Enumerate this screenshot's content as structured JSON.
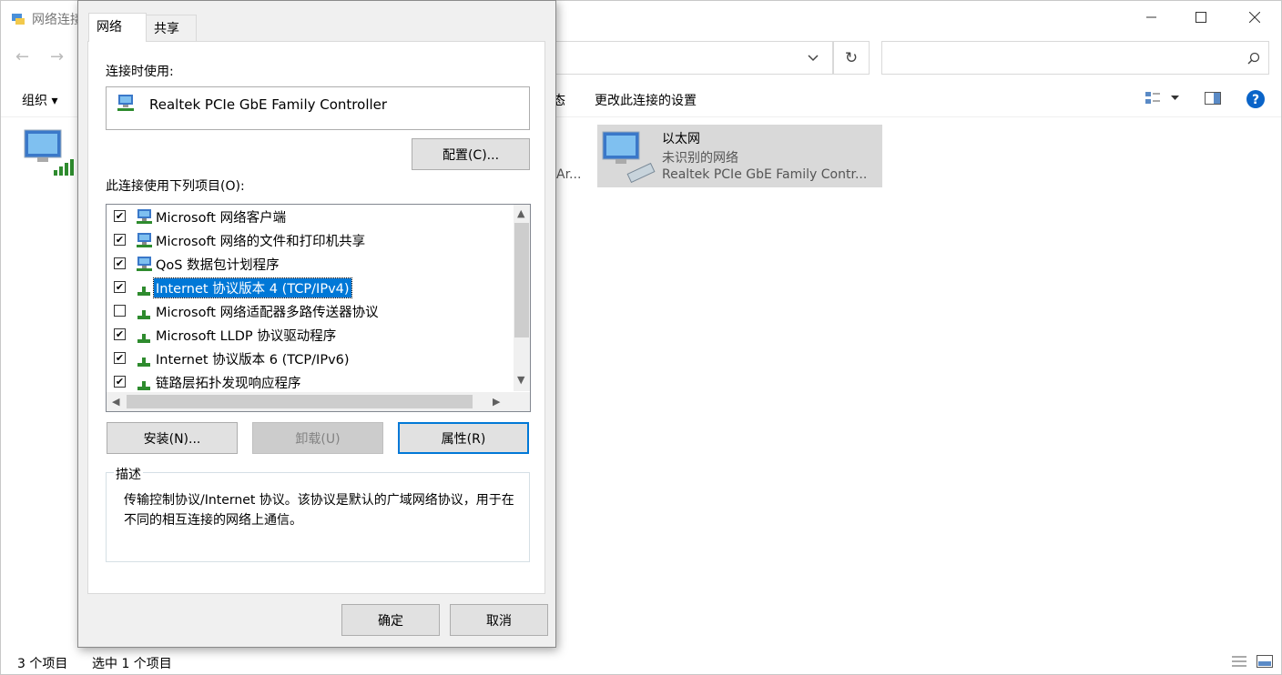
{
  "explorer": {
    "title": "网络连接",
    "toolbar": {
      "organize": "组织 ▾",
      "fragment": "态",
      "change_settings": "更改此连接的设置"
    },
    "adapters": [
      {
        "name": "以太网",
        "status": "未识别的网络",
        "device": "Realtek PCIe GbE Family Contr..."
      }
    ],
    "partial_label": "Ar...",
    "statusbar": {
      "count": "3 个项目",
      "selected": "选中 1 个项目"
    }
  },
  "dialog": {
    "tabs": [
      "网络",
      "共享"
    ],
    "connect_using_label": "连接时使用:",
    "adapter_name": "Realtek PCIe GbE Family Controller",
    "configure_button": "配置(C)...",
    "items_label": "此连接使用下列项目(O):",
    "items": [
      {
        "checked": true,
        "label": "Microsoft 网络客户端",
        "icon": "network-client-icon"
      },
      {
        "checked": true,
        "label": "Microsoft 网络的文件和打印机共享",
        "icon": "network-client-icon"
      },
      {
        "checked": true,
        "label": "QoS 数据包计划程序",
        "icon": "network-client-icon"
      },
      {
        "checked": true,
        "label": "Internet 协议版本 4 (TCP/IPv4)",
        "icon": "protocol-icon",
        "selected": true
      },
      {
        "checked": false,
        "label": "Microsoft 网络适配器多路传送器协议",
        "icon": "protocol-icon"
      },
      {
        "checked": true,
        "label": "Microsoft LLDP 协议驱动程序",
        "icon": "protocol-icon"
      },
      {
        "checked": true,
        "label": "Internet 协议版本 6 (TCP/IPv6)",
        "icon": "protocol-icon"
      },
      {
        "checked": true,
        "label": "链路层拓扑发现响应程序",
        "icon": "protocol-icon"
      }
    ],
    "install_button": "安装(N)...",
    "uninstall_button": "卸载(U)",
    "properties_button": "属性(R)",
    "description_legend": "描述",
    "description_text": "传输控制协议/Internet 协议。该协议是默认的广域网络协议，用于在不同的相互连接的网络上通信。",
    "ok_button": "确定",
    "cancel_button": "取消"
  }
}
